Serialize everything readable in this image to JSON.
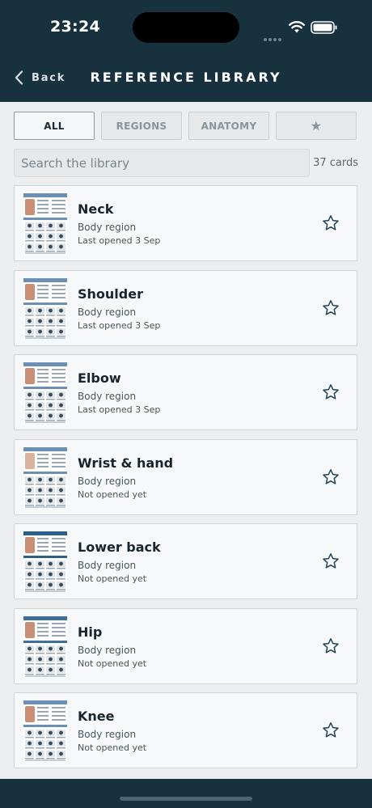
{
  "status_bar": {
    "time": "23:24"
  },
  "header": {
    "back_label": "Back",
    "title": "REFERENCE LIBRARY"
  },
  "tabs": [
    {
      "label": "ALL",
      "active": true
    },
    {
      "label": "REGIONS",
      "active": false
    },
    {
      "label": "ANATOMY",
      "active": false
    },
    {
      "label": "★",
      "active": false
    }
  ],
  "search": {
    "placeholder": "Search the library",
    "value": ""
  },
  "count_label": "37 cards",
  "cards": [
    {
      "name": "Neck",
      "type": "Body region",
      "status": "Last opened 3 Sep",
      "accent": "#6b8fb5",
      "figure": "#c98f76"
    },
    {
      "name": "Shoulder",
      "type": "Body region",
      "status": "Last opened 3 Sep",
      "accent": "#6b8fb5",
      "figure": "#c98f76"
    },
    {
      "name": "Elbow",
      "type": "Body region",
      "status": "Last opened 3 Sep",
      "accent": "#6b8fb5",
      "figure": "#c98f76"
    },
    {
      "name": "Wrist & hand",
      "type": "Body region",
      "status": "Not opened yet",
      "accent": "#6b8fb5",
      "figure": "#d8b39e"
    },
    {
      "name": "Lower back",
      "type": "Body region",
      "status": "Not opened yet",
      "accent": "#2c5f8a",
      "figure": "#c98f76"
    },
    {
      "name": "Hip",
      "type": "Body region",
      "status": "Not opened yet",
      "accent": "#3d6f9c",
      "figure": "#c98f76"
    },
    {
      "name": "Knee",
      "type": "Body region",
      "status": "Not opened yet",
      "accent": "#6b8fb5",
      "figure": "#c98f76"
    }
  ],
  "colors": {
    "header_bg": "#17313f",
    "page_bg": "#eceef0",
    "card_bg": "#f7f8f9",
    "star_outline": "#1f4457"
  }
}
